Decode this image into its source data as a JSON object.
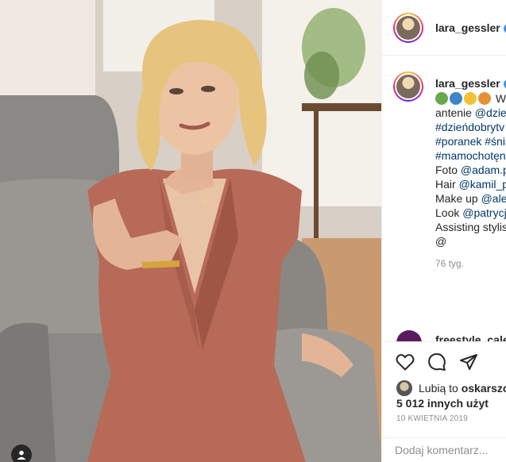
{
  "post": {
    "username": "lara_gessler",
    "verified_mark": "✓",
    "caption_lines": [
      {
        "pre": "",
        "emoji": [
          "#6aa84f",
          "#3d85c6",
          "#f1c232",
          "#e69138"
        ],
        "text": " W"
      },
      {
        "pre": "antenie ",
        "mention": "@dzien"
      },
      {
        "hashtag": "#dzieńdobrytv"
      },
      {
        "hashtag": "#poranek #śnia"
      },
      {
        "hashtag": "#mamochotęn"
      },
      {
        "pre": "Foto ",
        "mention": "@adam.p"
      },
      {
        "pre": "Hair ",
        "mention": "@kamil_p"
      },
      {
        "pre": "Make up ",
        "mention": "@ale"
      },
      {
        "pre": "Look ",
        "mention": "@patrycja"
      },
      {
        "pre": "Assisting stylist",
        "mention": ""
      },
      {
        "pre": "@",
        "mention": ""
      }
    ],
    "time_ago": "76 tyg.",
    "next_comment_user": "freestyle_calen",
    "likes_prefix": "Lubią to ",
    "likes_user": "oskarszcz",
    "likes_others": "5 012 innych użyt",
    "date": "10 KWIETNIA 2019",
    "comment_placeholder": "Dodaj komentarz..."
  },
  "icons": {
    "like": "heart-icon",
    "comment": "comment-icon",
    "share": "paper-plane-icon",
    "tag": "user-tag-icon"
  },
  "colors": {
    "link": "#00376b",
    "verified": "#3897f0",
    "dress": "#b76a57"
  }
}
